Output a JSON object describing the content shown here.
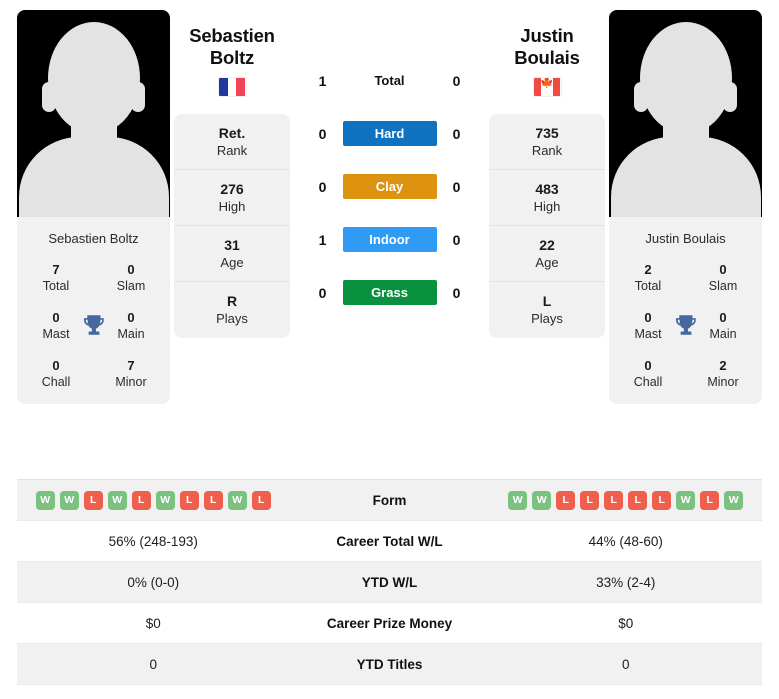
{
  "players": {
    "left": {
      "first_name": "Sebastien",
      "last_name": "Boltz",
      "full_name": "Sebastien Boltz",
      "country": "France",
      "flag_icon": "flag-france-icon",
      "rank": "Ret.",
      "rank_label": "Rank",
      "high": "276",
      "high_label": "High",
      "age": "31",
      "age_label": "Age",
      "plays": "R",
      "plays_label": "Plays",
      "titles": {
        "total": "7",
        "total_label": "Total",
        "slam": "0",
        "slam_label": "Slam",
        "mast": "0",
        "mast_label": "Mast",
        "main": "0",
        "main_label": "Main",
        "chall": "0",
        "chall_label": "Chall",
        "minor": "7",
        "minor_label": "Minor"
      },
      "form": [
        "W",
        "W",
        "L",
        "W",
        "L",
        "W",
        "L",
        "L",
        "W",
        "L"
      ],
      "career_total_wl": "56% (248-193)",
      "ytd_wl": "0% (0-0)",
      "career_prize_money": "$0",
      "ytd_titles": "0"
    },
    "right": {
      "first_name": "Justin",
      "last_name": "Boulais",
      "full_name": "Justin Boulais",
      "country": "Canada",
      "flag_icon": "flag-canada-icon",
      "rank": "735",
      "rank_label": "Rank",
      "high": "483",
      "high_label": "High",
      "age": "22",
      "age_label": "Age",
      "plays": "L",
      "plays_label": "Plays",
      "titles": {
        "total": "2",
        "total_label": "Total",
        "slam": "0",
        "slam_label": "Slam",
        "mast": "0",
        "mast_label": "Mast",
        "main": "0",
        "main_label": "Main",
        "chall": "0",
        "chall_label": "Chall",
        "minor": "2",
        "minor_label": "Minor"
      },
      "form": [
        "W",
        "W",
        "L",
        "L",
        "L",
        "L",
        "L",
        "W",
        "L",
        "W"
      ],
      "career_total_wl": "44% (48-60)",
      "ytd_wl": "33% (2-4)",
      "career_prize_money": "$0",
      "ytd_titles": "0"
    }
  },
  "head_to_head": {
    "rows": [
      {
        "label": "Total",
        "left": "1",
        "right": "0",
        "style": "plain",
        "color": ""
      },
      {
        "label": "Hard",
        "left": "0",
        "right": "0",
        "style": "badge",
        "color": "#0f72c0"
      },
      {
        "label": "Clay",
        "left": "0",
        "right": "0",
        "style": "badge",
        "color": "#dd9210"
      },
      {
        "label": "Indoor",
        "left": "1",
        "right": "0",
        "style": "badge",
        "color": "#2f9bf5"
      },
      {
        "label": "Grass",
        "left": "0",
        "right": "0",
        "style": "badge",
        "color": "#0a9140"
      }
    ]
  },
  "comparison_table": {
    "rows": [
      {
        "label": "Form",
        "type": "form"
      },
      {
        "label": "Career Total W/L",
        "type": "text",
        "key": "career_total_wl"
      },
      {
        "label": "YTD W/L",
        "type": "text",
        "key": "ytd_wl"
      },
      {
        "label": "Career Prize Money",
        "type": "text",
        "key": "career_prize_money"
      },
      {
        "label": "YTD Titles",
        "type": "text",
        "key": "ytd_titles"
      }
    ]
  },
  "colors": {
    "hard": "#0f72c0",
    "clay": "#dd9210",
    "indoor": "#2f9bf5",
    "grass": "#0a9140",
    "win": "#7ac27e",
    "loss": "#ef5f4c",
    "card_bg": "#f1f1f1"
  }
}
